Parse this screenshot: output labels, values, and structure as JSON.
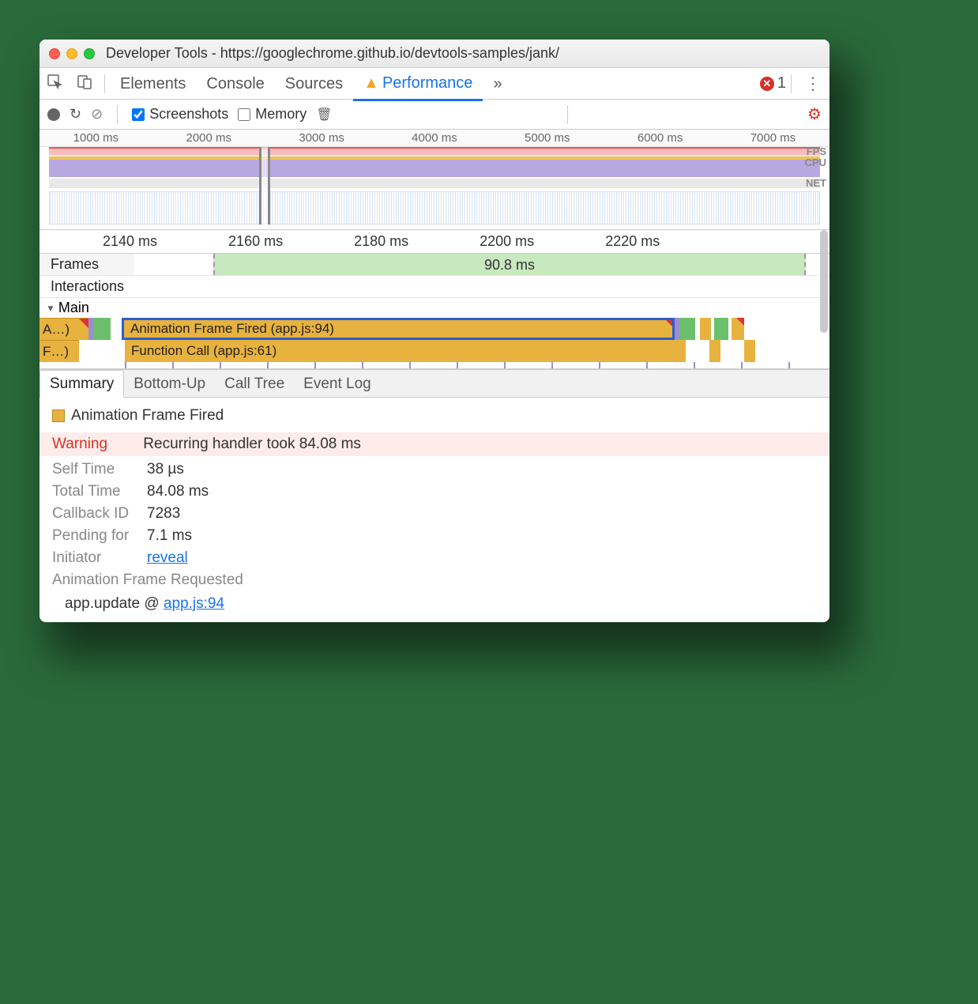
{
  "title": "Developer Tools - https://googlechrome.github.io/devtools-samples/jank/",
  "tabs": {
    "elements": "Elements",
    "console": "Console",
    "sources": "Sources",
    "performance": "Performance",
    "more": "»"
  },
  "errors": "1",
  "toolbar": {
    "screenshots": "Screenshots",
    "memory": "Memory"
  },
  "overview_ticks": [
    "1000 ms",
    "2000 ms",
    "3000 ms",
    "4000 ms",
    "5000 ms",
    "6000 ms",
    "7000 ms"
  ],
  "overview_labels": {
    "fps": "FPS",
    "cpu": "CPU",
    "net": "NET"
  },
  "detail_ticks": [
    "2140 ms",
    "2160 ms",
    "2180 ms",
    "2200 ms",
    "2220 ms"
  ],
  "tracks": {
    "frames": "Frames",
    "frames_value": "90.8 ms",
    "interactions": "Interactions",
    "main": "Main"
  },
  "flame": {
    "stub1": "A…)",
    "stub2": "F…)",
    "af": "Animation Frame Fired (app.js:94)",
    "fc": "Function Call (app.js:61)"
  },
  "sub_tabs": {
    "summary": "Summary",
    "bottom": "Bottom-Up",
    "tree": "Call Tree",
    "log": "Event Log"
  },
  "summary": {
    "title": "Animation Frame Fired",
    "warning_label": "Warning",
    "warning_text": "Recurring handler took 84.08 ms",
    "self_time_k": "Self Time",
    "self_time_v": "38 µs",
    "total_time_k": "Total Time",
    "total_time_v": "84.08 ms",
    "callback_k": "Callback ID",
    "callback_v": "7283",
    "pending_k": "Pending for",
    "pending_v": "7.1 ms",
    "initiator_k": "Initiator",
    "initiator_v": "reveal",
    "requested": "Animation Frame Requested",
    "call": "app.update @ ",
    "call_link": "app.js:94"
  }
}
